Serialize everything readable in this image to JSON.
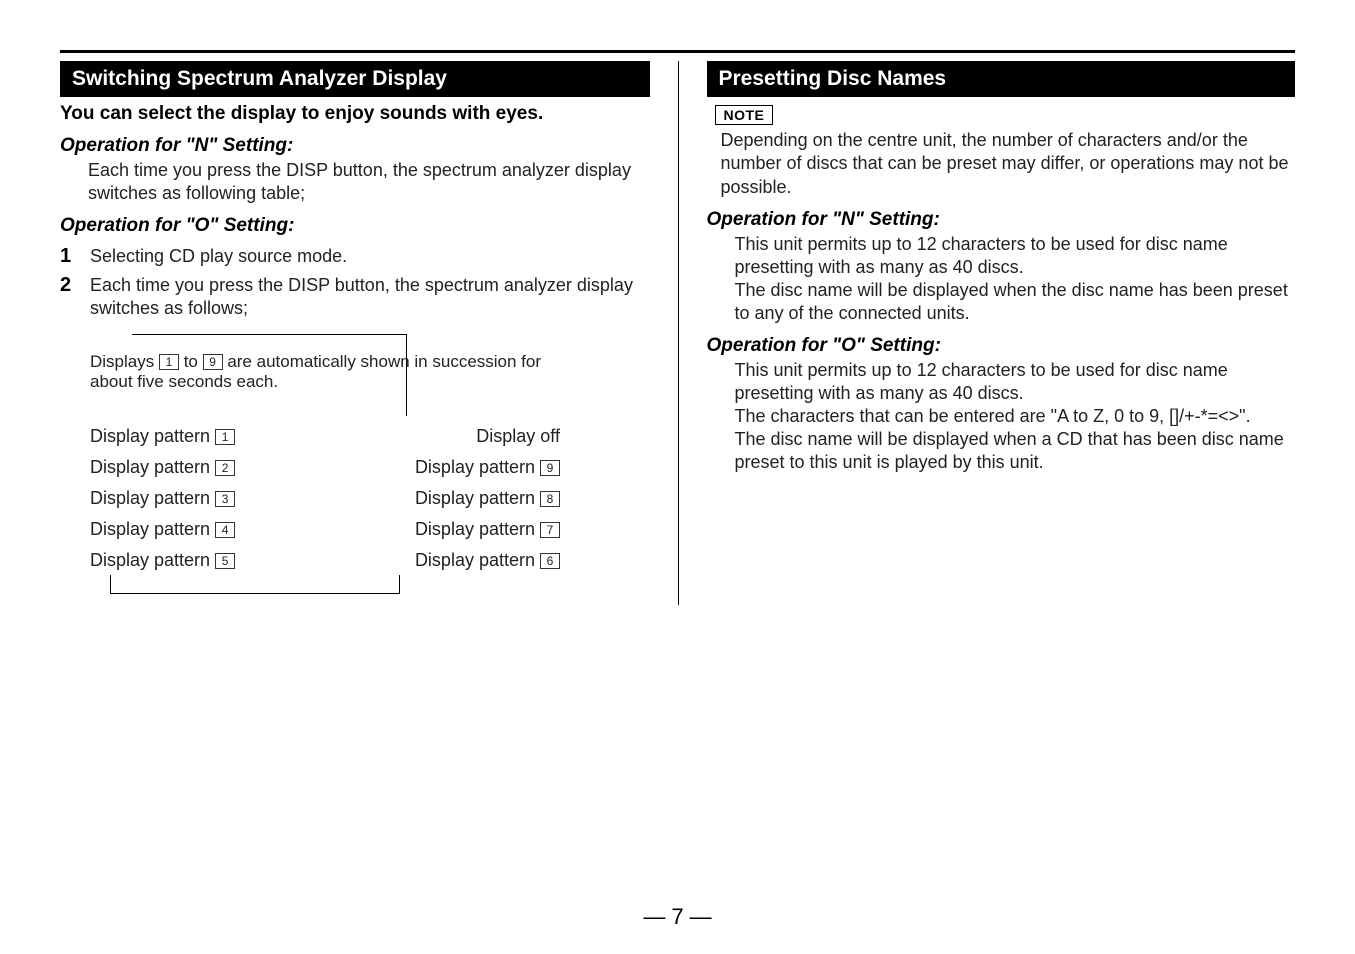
{
  "left": {
    "section_title": "Switching Spectrum Analyzer Display",
    "lead": "You can select the display to enjoy sounds with eyes.",
    "op_n_heading": "Operation for \"N\" Setting:",
    "op_n_body": "Each time you press the DISP button, the spectrum analyzer display switches as following table;",
    "op_o_heading": "Operation for \"O\" Setting:",
    "steps": [
      {
        "num": "1",
        "text": "Selecting CD play source mode."
      },
      {
        "num": "2",
        "text": "Each time you press the DISP button, the spectrum analyzer display switches as follows;"
      }
    ],
    "flow": {
      "intro_pre": "Displays ",
      "intro_a": "1",
      "intro_mid": " to ",
      "intro_b": "9",
      "intro_post": " are automatically shown in succession for about five seconds each.",
      "rows": [
        {
          "left_label": "Display pattern ",
          "left_num": "1",
          "right_label": "Display off",
          "right_num": ""
        },
        {
          "left_label": "Display pattern ",
          "left_num": "2",
          "right_label": "Display pattern ",
          "right_num": "9"
        },
        {
          "left_label": "Display pattern ",
          "left_num": "3",
          "right_label": "Display pattern ",
          "right_num": "8"
        },
        {
          "left_label": "Display pattern ",
          "left_num": "4",
          "right_label": "Display pattern ",
          "right_num": "7"
        },
        {
          "left_label": "Display pattern ",
          "left_num": "5",
          "right_label": "Display pattern ",
          "right_num": "6"
        }
      ]
    }
  },
  "right": {
    "section_title": "Presetting Disc Names",
    "note_label": "NOTE",
    "note_body": "Depending on the centre unit, the number of characters and/or the number of discs that can be preset may differ, or operations may not be possible.",
    "op_n_heading": "Operation for \"N\" Setting:",
    "op_n_body": "This unit permits up to 12 characters to be used for disc name presetting with as many as 40 discs.\nThe disc name will be displayed when the disc name has been preset to any of the connected units.",
    "op_o_heading": "Operation for \"O\" Setting:",
    "op_o_body": "This unit permits up to 12 characters to be used for disc name presetting with as many as 40 discs.\nThe characters that can be entered are \"A to Z, 0 to 9, []/+-*=<>\".\nThe disc name will be displayed when a CD that has been disc name preset to this unit is played by this unit."
  },
  "page_number": "7"
}
